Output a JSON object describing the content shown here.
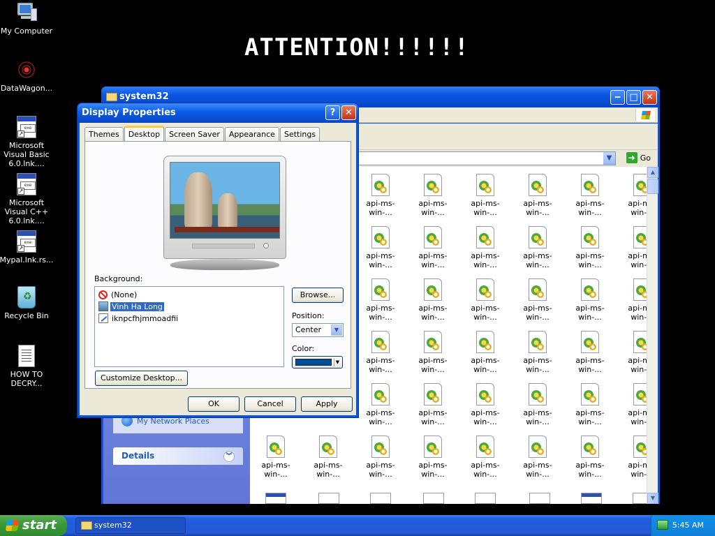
{
  "desktop": {
    "banner": "ATTENTION!!!!!!",
    "icons": [
      {
        "label": "My Computer",
        "icon": "my-computer-icon"
      },
      {
        "label": "DataWagon...",
        "icon": "datawagon-icon"
      },
      {
        "label": "Microsoft Visual Basic 6.0.lnk....",
        "icon": "shortcut-icon"
      },
      {
        "label": "Microsoft Visual C++ 6.0.lnk....",
        "icon": "shortcut-icon"
      },
      {
        "label": "Mypal.lnk.rs...",
        "icon": "shortcut-icon"
      },
      {
        "label": "Recycle Bin",
        "icon": "recycle-bin-icon"
      },
      {
        "label": "HOW TO DECRY...",
        "icon": "text-file-icon"
      }
    ]
  },
  "explorer": {
    "title": "system32",
    "address_go": "Go",
    "side": {
      "network_places": "My Network Places",
      "details_header": "Details"
    },
    "file_label": "api-ms-win-..."
  },
  "dialog": {
    "title": "Display Properties",
    "help": "?",
    "close": "✕",
    "tabs": [
      "Themes",
      "Desktop",
      "Screen Saver",
      "Appearance",
      "Settings"
    ],
    "active_tab": "Desktop",
    "background_label": "Background:",
    "backgrounds": [
      "(None)",
      "Vinh Ha Long",
      "iknpcfhjmmoadfii"
    ],
    "selected_background": "Vinh Ha Long",
    "browse_button": "Browse...",
    "position_label": "Position:",
    "position_value": "Center",
    "color_label": "Color:",
    "color_value": "#004e98",
    "customize_button": "Customize Desktop...",
    "ok_button": "OK",
    "cancel_button": "Cancel",
    "apply_button": "Apply"
  },
  "taskbar": {
    "start_label": "start",
    "task_label": "system32",
    "clock": "5:45 AM"
  }
}
